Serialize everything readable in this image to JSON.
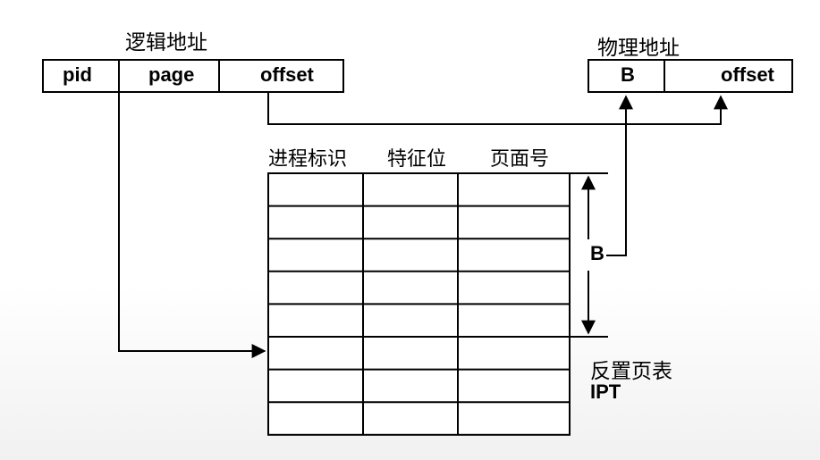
{
  "logical_address": {
    "title": "逻辑地址",
    "fields": [
      "pid",
      "page",
      "offset"
    ]
  },
  "physical_address": {
    "title": "物理地址",
    "fields": [
      "B",
      "offset"
    ]
  },
  "table": {
    "columns": [
      "进程标识",
      "特征位",
      "页面号"
    ],
    "row_count": 8,
    "index_label": "B",
    "name": "反置页表",
    "abbr": "IPT"
  }
}
